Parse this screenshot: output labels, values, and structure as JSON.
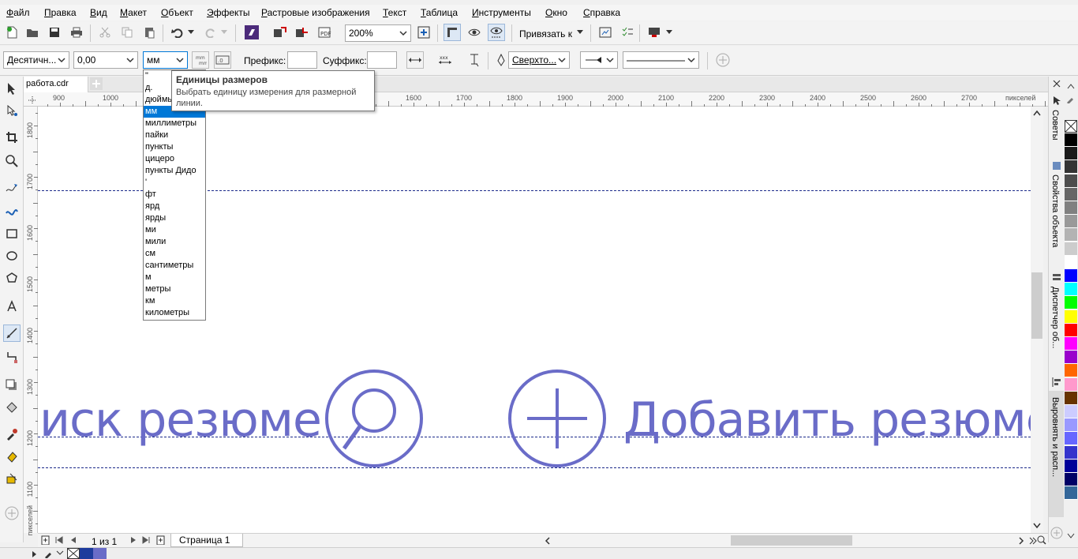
{
  "menu": [
    "Файл",
    "Правка",
    "Вид",
    "Макет",
    "Объект",
    "Эффекты",
    "Растровые изображения",
    "Текст",
    "Таблица",
    "Инструменты",
    "Окно",
    "Справка"
  ],
  "toolbar1": {
    "zoom": "200%",
    "snap_label": "Привязать к"
  },
  "toolbar2": {
    "dimension_style": "Десятичн...",
    "precision": "0,00",
    "units": "мм",
    "prefix_label": "Префикс:",
    "suffix_label": "Суффикс:",
    "text_position": "Сверхто..."
  },
  "tooltip": {
    "title": "Единицы размеров",
    "desc": "Выбрать единицу измерения для размерной линии."
  },
  "units_dropdown": {
    "options": [
      "\"",
      "д.",
      "дюймы",
      "мм",
      "миллиметры",
      "пайки",
      "пункты",
      "цицеро",
      "пункты Дидо",
      "'",
      "фт",
      "ярд",
      "ярды",
      "ми",
      "мили",
      "см",
      "сантиметры",
      "м",
      "метры",
      "км",
      "километры"
    ],
    "selected_index": 3
  },
  "document": {
    "tab": "работа.cdr",
    "page_indicator": "1 из 1",
    "page_tab": "Страница 1"
  },
  "rulers": {
    "h_ticks": [
      "900",
      "1000",
      "1600",
      "1700",
      "1800",
      "1900",
      "2000",
      "2100",
      "2200",
      "2300",
      "2400",
      "2500",
      "2600",
      "2700"
    ],
    "h_unit": "пикселей",
    "v_ticks": [
      "1800",
      "1700",
      "1600",
      "1500",
      "1400",
      "1300",
      "1200",
      "1100"
    ],
    "v_unit": "пикселей"
  },
  "canvas": {
    "text_left": "иск резюме",
    "text_right": "Добавить резюме",
    "art_color": "#6a6cc8",
    "guide_color": "#1b2a8a"
  },
  "dockers": [
    "Советы",
    "Свойства объекта",
    "Диспетчер об...",
    "Выровнять и расп..."
  ],
  "palette": [
    "#000000",
    "#1a1a1a",
    "#333333",
    "#4d4d4d",
    "#666666",
    "#808080",
    "#999999",
    "#b3b3b3",
    "#cccccc",
    "#ffffff",
    "#0000ff",
    "#00ffff",
    "#00ff00",
    "#ffff00",
    "#ff0000",
    "#ff00ff",
    "#9900cc",
    "#ff6600",
    "#ff99cc",
    "#663300",
    "#ccccff",
    "#9999ff",
    "#6666ff",
    "#3333cc",
    "#000099",
    "#000066",
    "#336699"
  ]
}
